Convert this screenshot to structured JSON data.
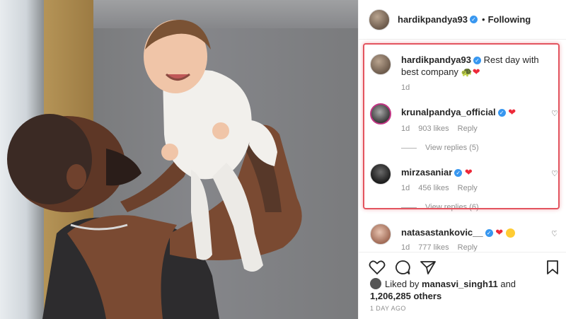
{
  "post": {
    "username": "hardikpandya93",
    "follow_status": "Following",
    "more": "•••"
  },
  "caption": {
    "username": "hardikpandya93",
    "text": "Rest day with best company",
    "emoji": "🐢❤",
    "time": "1d"
  },
  "comments": [
    {
      "username": "krunalpandya_official",
      "text": "❤",
      "time": "1d",
      "likes": "903 likes",
      "reply": "Reply",
      "view_replies": "View replies (5)"
    },
    {
      "username": "mirzasaniar",
      "text": "❤",
      "time": "1d",
      "likes": "456 likes",
      "reply": "Reply",
      "view_replies": "View replies (6)"
    },
    {
      "username": "natasastankovic__",
      "text": "❤",
      "time": "1d",
      "likes": "777 likes",
      "reply": "Reply"
    }
  ],
  "likes": {
    "prefix": "Liked by",
    "user": "manasvi_singh11",
    "and": "and",
    "others": "1,206,285 others"
  },
  "time_ago": "1 DAY AGO",
  "colors": {
    "verified": "#3897f0",
    "highlight": "#e3545f",
    "heart": "#ed2939"
  }
}
